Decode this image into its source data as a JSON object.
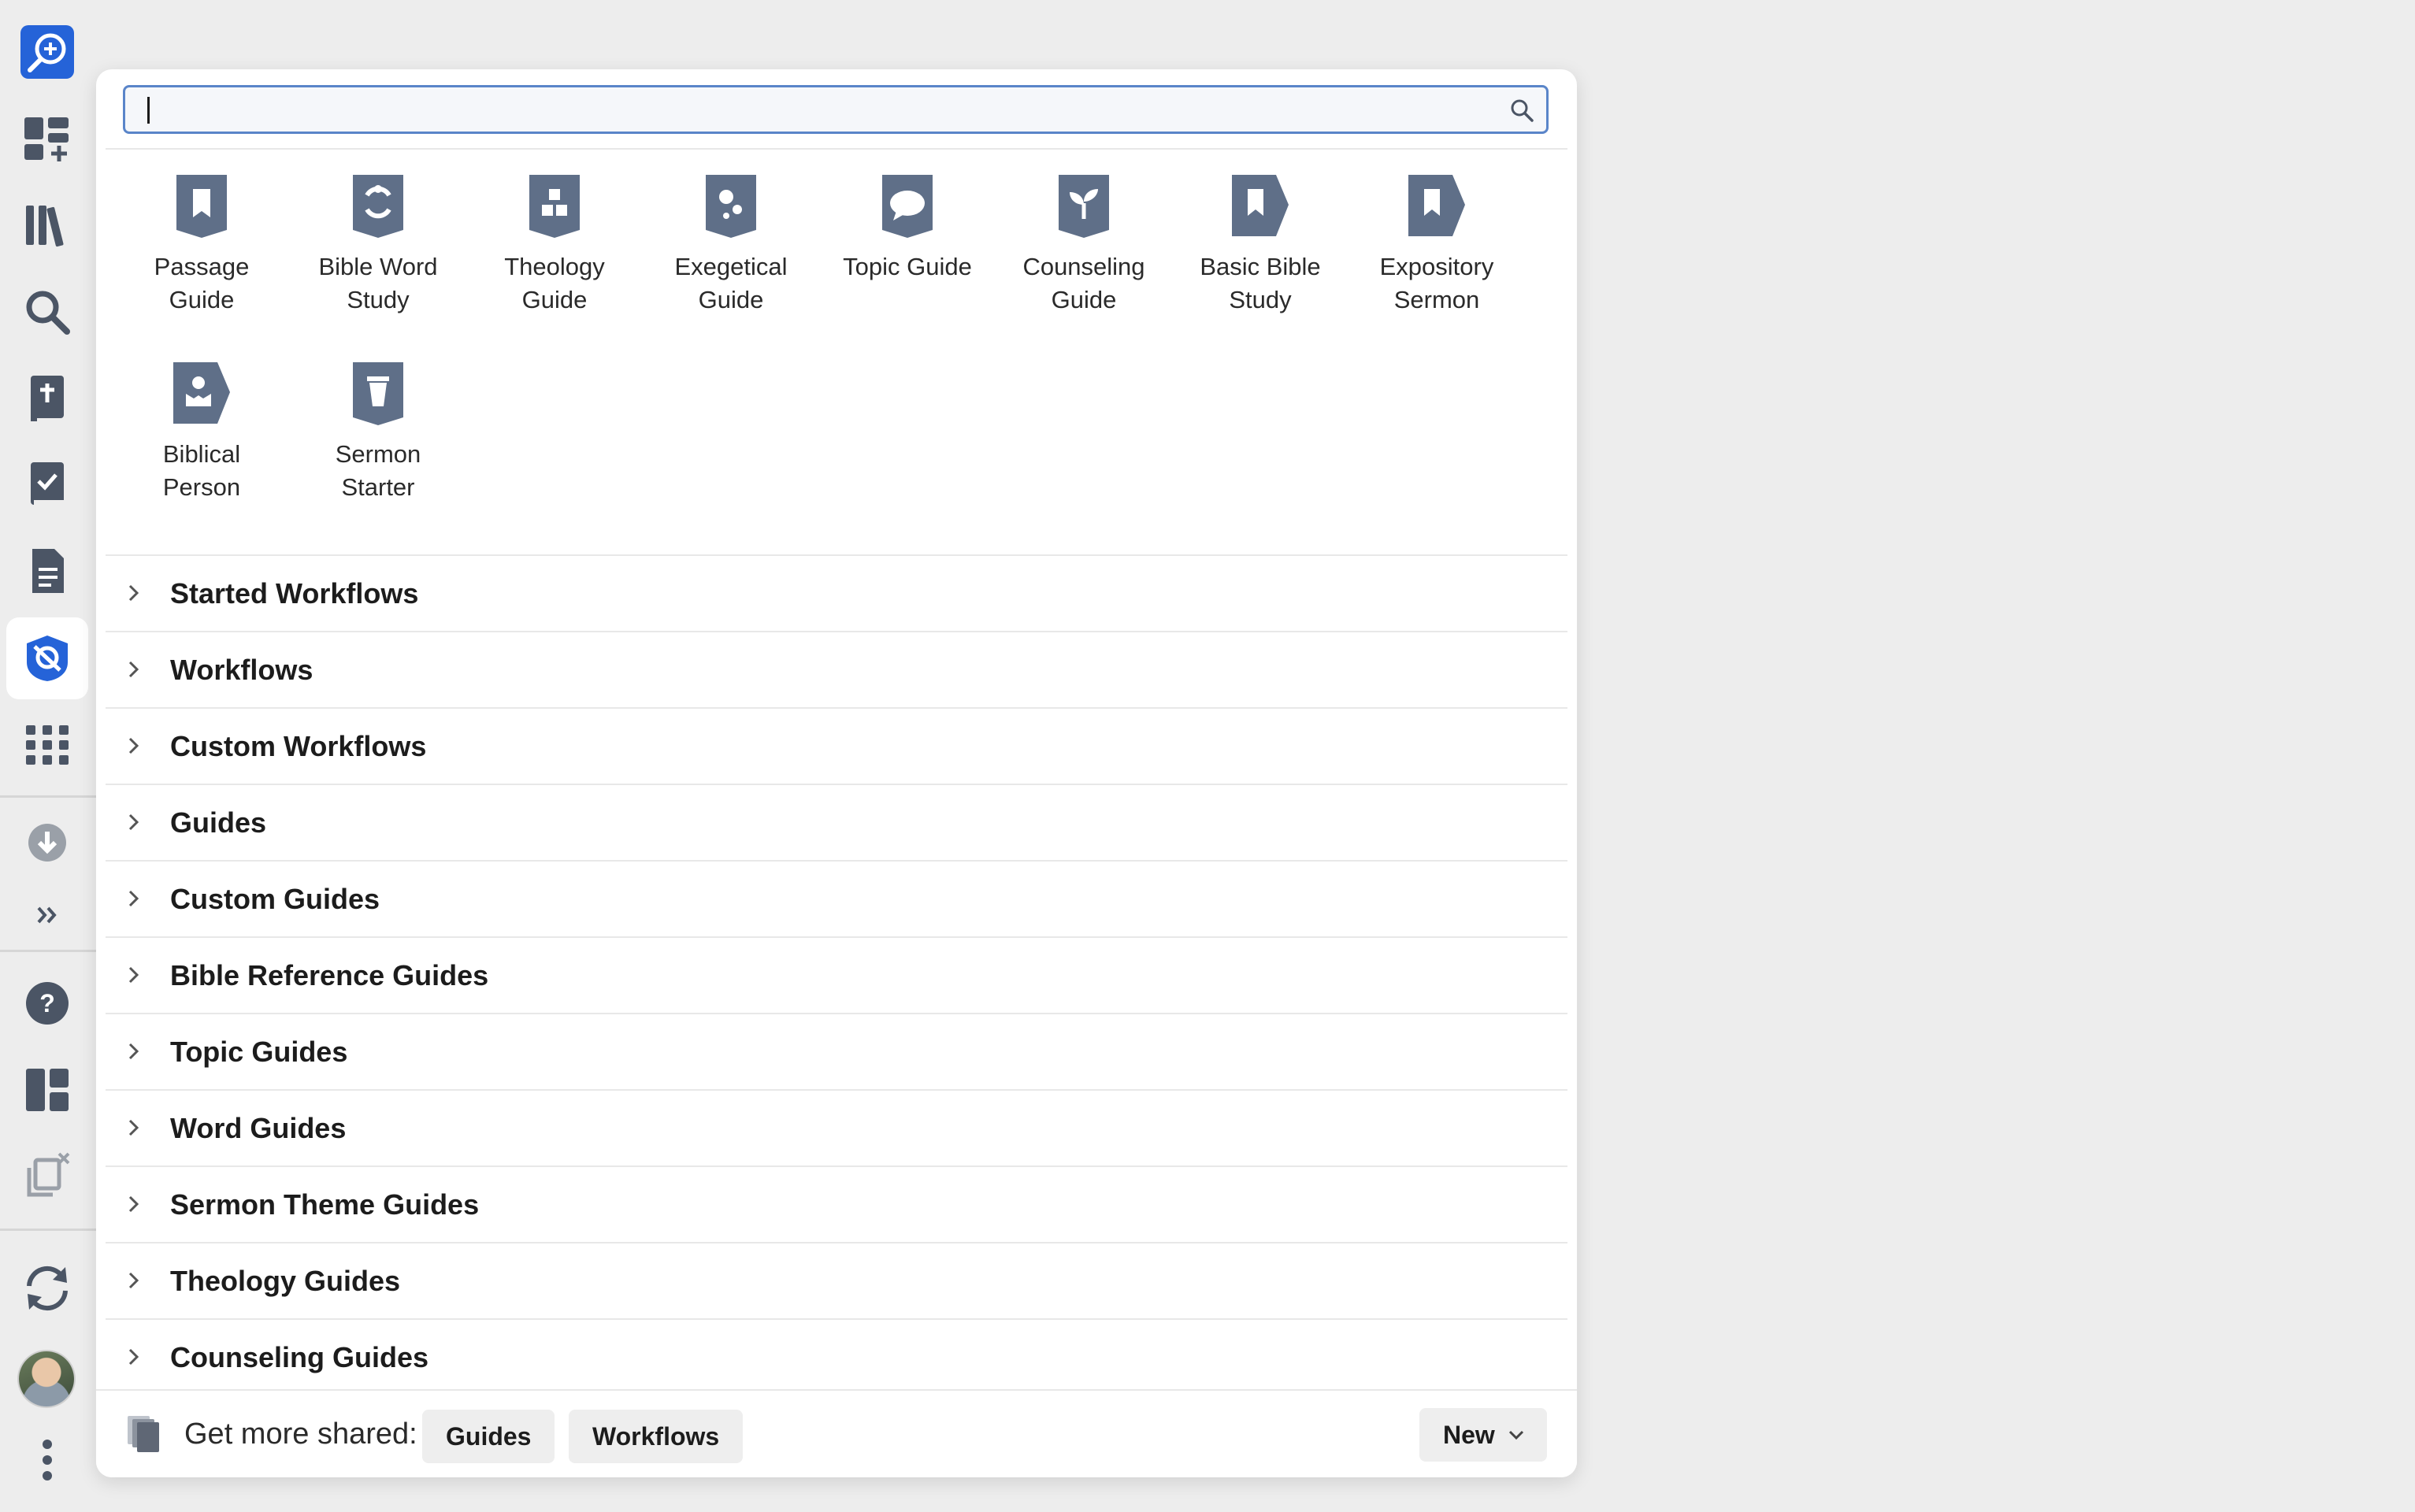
{
  "sidebar": {
    "items": [
      {
        "name": "search-assistant-icon"
      },
      {
        "name": "add-layout-icon"
      },
      {
        "name": "library-icon"
      },
      {
        "name": "search-icon"
      },
      {
        "name": "bible-icon"
      },
      {
        "name": "reading-plan-icon"
      },
      {
        "name": "document-icon"
      },
      {
        "name": "guides-icon",
        "active": true
      },
      {
        "name": "apps-grid-icon"
      },
      {
        "name": "download-icon"
      },
      {
        "name": "expand-icon"
      },
      {
        "name": "help-icon"
      },
      {
        "name": "panel-layout-icon"
      },
      {
        "name": "close-panels-icon"
      },
      {
        "name": "sync-icon"
      },
      {
        "name": "user-avatar"
      },
      {
        "name": "more-vertical-icon"
      }
    ],
    "accent": "#2563d8"
  },
  "search": {
    "value": "",
    "placeholder": ""
  },
  "tiles": [
    {
      "id": "passage-guide",
      "label": "Passage\nGuide",
      "icon": "bookmark-shield"
    },
    {
      "id": "bible-word-study",
      "label": "Bible Word\nStudy",
      "icon": "rotate-shield"
    },
    {
      "id": "theology-guide",
      "label": "Theology\nGuide",
      "icon": "blocks-shield"
    },
    {
      "id": "exegetical-guide",
      "label": "Exegetical\nGuide",
      "icon": "dots-shield"
    },
    {
      "id": "topic-guide",
      "label": "Topic Guide",
      "icon": "speech-shield"
    },
    {
      "id": "counseling-guide",
      "label": "Counseling\nGuide",
      "icon": "sprout-shield"
    },
    {
      "id": "basic-bible-study",
      "label": "Basic Bible\nStudy",
      "icon": "bookmark-tag"
    },
    {
      "id": "expository-sermon",
      "label": "Expository\nSermon",
      "icon": "bookmark-tag"
    },
    {
      "id": "biblical-person",
      "label": "Biblical\nPerson",
      "icon": "person-tag"
    },
    {
      "id": "sermon-starter",
      "label": "Sermon\nStarter",
      "icon": "cup-shield"
    }
  ],
  "sections": [
    {
      "label": "Started Workflows"
    },
    {
      "label": "Workflows"
    },
    {
      "label": "Custom Workflows"
    },
    {
      "label": "Guides"
    },
    {
      "label": "Custom Guides"
    },
    {
      "label": "Bible Reference Guides"
    },
    {
      "label": "Topic Guides"
    },
    {
      "label": "Word Guides"
    },
    {
      "label": "Sermon Theme Guides"
    },
    {
      "label": "Theology Guides"
    },
    {
      "label": "Counseling Guides"
    }
  ],
  "footer": {
    "get_more_label": "Get more shared:",
    "guides_label": "Guides",
    "workflows_label": "Workflows",
    "new_label": "New"
  },
  "colors": {
    "tile_icon": "#5f6f88",
    "rail_icon": "#4b5565",
    "search_border": "#5a85c9"
  }
}
